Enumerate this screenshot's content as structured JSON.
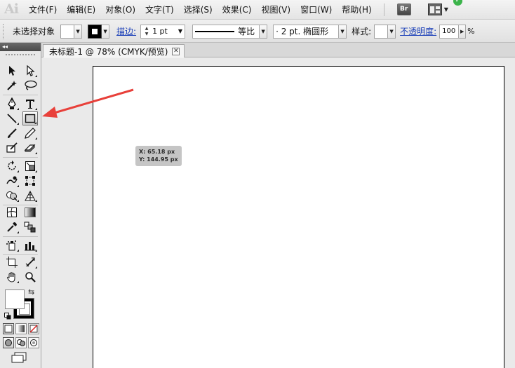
{
  "app": {
    "logo": "Ai"
  },
  "menu": [
    "文件(F)",
    "编辑(E)",
    "对象(O)",
    "文字(T)",
    "选择(S)",
    "效果(C)",
    "视图(V)",
    "窗口(W)",
    "帮助(H)"
  ],
  "menubar_icons": {
    "bridge_label": "Br",
    "bridge_icon": "bridge-icon",
    "workspace_icon": "workspace-layout-icon"
  },
  "control_bar": {
    "selection_label": "未选择对象",
    "stroke_link": "描边:",
    "stroke_weight": "1 pt",
    "stroke_profile": "等比",
    "brush_size": "·  2 pt. 椭圆形",
    "style_label": "样式:",
    "opacity_link": "不透明度:",
    "opacity_value": "100",
    "opacity_unit": "%"
  },
  "tools_panel": {
    "collapse_glyph": "◂◂"
  },
  "document_tab": {
    "title": "未标题-1 @ 78% (CMYK/预览)",
    "close_glyph": "✕"
  },
  "cursor_readout": {
    "x_label": "X: 65.18 px",
    "y_label": "Y: 144.95 px"
  },
  "annotation": {
    "color": "#e8403a"
  },
  "colors": {
    "stroke": "#000000",
    "fill": "#ffffff",
    "workspace_badge": "#3cb44b"
  }
}
